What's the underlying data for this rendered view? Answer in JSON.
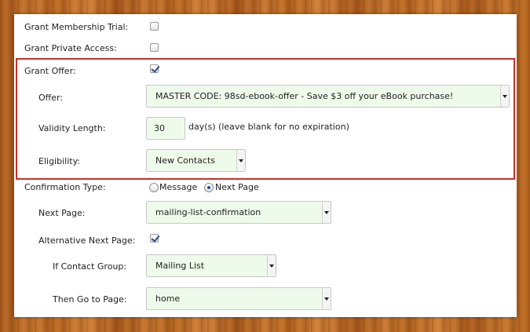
{
  "form": {
    "grant_membership_trial": {
      "label": "Grant Membership Trial:",
      "checked": false
    },
    "grant_private_access": {
      "label": "Grant Private Access:",
      "checked": false
    },
    "grant_offer": {
      "label": "Grant Offer:",
      "checked": true,
      "offer": {
        "label": "Offer:",
        "value": "MASTER CODE: 98sd-ebook-offer - Save $3 off your eBook purchase!"
      },
      "validity": {
        "label": "Validity Length:",
        "value": "30",
        "suffix": "day(s) (leave blank for no expiration)"
      },
      "eligibility": {
        "label": "Eligibility:",
        "value": "New Contacts"
      }
    },
    "confirmation_type": {
      "label": "Confirmation Type:",
      "options": [
        "Message",
        "Next Page"
      ],
      "selected": "Next Page"
    },
    "next_page": {
      "label": "Next Page:",
      "value": "mailing-list-confirmation"
    },
    "alternative_next_page": {
      "label": "Alternative Next Page:",
      "checked": true
    },
    "if_contact_group": {
      "label": "If Contact Group:",
      "value": "Mailing List"
    },
    "then_go_to_page": {
      "label": "Then Go to Page:",
      "value": "home"
    }
  },
  "colors": {
    "highlight_border": "#c9302c",
    "field_background": "#effbea",
    "checkmark": "#2a4d8f"
  }
}
